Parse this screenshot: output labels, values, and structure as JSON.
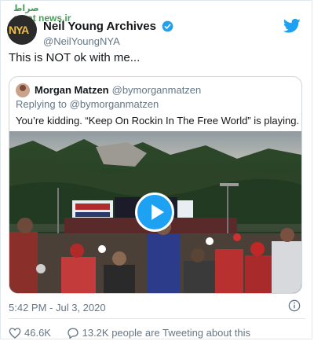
{
  "watermark": {
    "line1": "صراط",
    "line2": "serat news.ir"
  },
  "author": {
    "avatar_text": "NYA",
    "display_name": "Neil Young Archives",
    "handle": "@NeilYoungNYA"
  },
  "tweet": {
    "text": "This is NOT ok with me..."
  },
  "quoted": {
    "display_name": "Morgan Matzen",
    "handle": "@bymorganmatzen",
    "replying_to": "Replying to @bymorganmatzen",
    "text": "You’re kidding. “Keep On Rockin In The Free World” is playing.",
    "video_icon": "play-icon"
  },
  "meta": {
    "timestamp": "5:42 PM - Jul 3, 2020"
  },
  "actions": {
    "likes": "46.6K",
    "tweeting": "13.2K people are Tweeting about this"
  },
  "colors": {
    "accent": "#1da1f2",
    "secondary_text": "#657786",
    "border": "#e1e8ed",
    "like_red": "#e0245e"
  }
}
